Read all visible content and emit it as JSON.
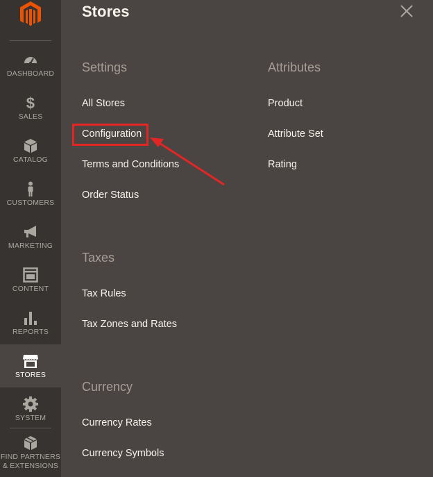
{
  "sidebar": {
    "items": [
      {
        "label": "DASHBOARD",
        "icon": "dashboard-icon"
      },
      {
        "label": "SALES",
        "icon": "dollar-icon"
      },
      {
        "label": "CATALOG",
        "icon": "cube-icon"
      },
      {
        "label": "CUSTOMERS",
        "icon": "person-icon"
      },
      {
        "label": "MARKETING",
        "icon": "megaphone-icon"
      },
      {
        "label": "CONTENT",
        "icon": "layout-icon"
      },
      {
        "label": "REPORTS",
        "icon": "bar-chart-icon"
      },
      {
        "label": "STORES",
        "icon": "storefront-icon"
      },
      {
        "label": "SYSTEM",
        "icon": "gear-icon"
      },
      {
        "label1": "FIND PARTNERS",
        "label2": "& EXTENSIONS",
        "icon": "blocks-icon"
      }
    ],
    "active": "STORES"
  },
  "panel": {
    "title": "Stores",
    "close_icon": "close-icon",
    "settings": {
      "title": "Settings",
      "links": [
        "All Stores",
        "Configuration",
        "Terms and Conditions",
        "Order Status"
      ]
    },
    "attributes": {
      "title": "Attributes",
      "links": [
        "Product",
        "Attribute Set",
        "Rating"
      ]
    },
    "taxes": {
      "title": "Taxes",
      "links": [
        "Tax Rules",
        "Tax Zones and Rates"
      ]
    },
    "currency": {
      "title": "Currency",
      "links": [
        "Currency Rates",
        "Currency Symbols"
      ]
    }
  },
  "colors": {
    "sidebar_bg": "#373330",
    "panel_bg": "#4a4542",
    "brand_orange": "#eb5202",
    "highlight_red": "#e22626"
  }
}
